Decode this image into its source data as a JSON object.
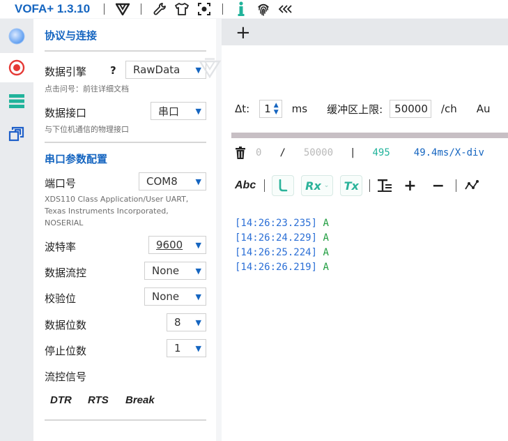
{
  "app": {
    "title": "VOFA+ 1.3.10"
  },
  "toolbar_icons": [
    "vofa-logo-icon",
    "wrench-icon",
    "shirt-icon",
    "focus-capture-icon",
    "info-icon",
    "fingerprint-icon",
    "collapse-left-icon"
  ],
  "rail": {
    "items": [
      "connection-status-icon",
      "record-icon",
      "list-icon",
      "windows-icon"
    ]
  },
  "settings": {
    "section1_title": "协议与连接",
    "engine_label": "数据引擎",
    "engine_help": "?",
    "engine_value": "RawData",
    "engine_hint": "点击问号：前往详细文档",
    "interface_label": "数据接口",
    "interface_value": "串口",
    "interface_hint": "与下位机通信的物理接口",
    "section2_title": "串口参数配置",
    "port_label": "端口号",
    "port_value": "COM8",
    "port_desc_1": "XDS110 Class Application/User UART,",
    "port_desc_2": "Texas Instruments Incorporated,",
    "port_desc_3": "NOSERIAL",
    "baud_label": "波特率",
    "baud_value": "9600",
    "flow_label": "数据流控",
    "flow_value": "None",
    "parity_label": "校验位",
    "parity_value": "None",
    "databits_label": "数据位数",
    "databits_value": "8",
    "stopbits_label": "停止位数",
    "stopbits_value": "1",
    "flowsig_label": "流控信号",
    "dtr": "DTR",
    "rts": "RTS",
    "break": "Break"
  },
  "main": {
    "add_tab": "+",
    "dt_label": "Δt:",
    "dt_value": "1",
    "dt_unit": "ms",
    "buffer_label": "缓冲区上限:",
    "buffer_value": "50000",
    "buffer_unit": "/ch",
    "auto_label": "Au",
    "stats": {
      "current": "0",
      "slash": "/",
      "max": "50000",
      "bar": "|",
      "count": "495",
      "xdiv": "49.4ms/X-div"
    },
    "toolbar": {
      "abc": "Abc",
      "rx": "Rx",
      "tx": "Tx",
      "plus": "+",
      "minus": "−"
    },
    "log": [
      {
        "ts": "[14:26:23.235]",
        "msg": "A"
      },
      {
        "ts": "[14:26:24.229]",
        "msg": "A"
      },
      {
        "ts": "[14:26:25.224]",
        "msg": "A"
      },
      {
        "ts": "[14:26:26.219]",
        "msg": "A"
      }
    ]
  },
  "colors": {
    "accent": "#1565c0",
    "teal": "#2bb39a",
    "timestamp": "#2b6fd6",
    "message": "#1f9d3f",
    "record": "#e53935"
  }
}
